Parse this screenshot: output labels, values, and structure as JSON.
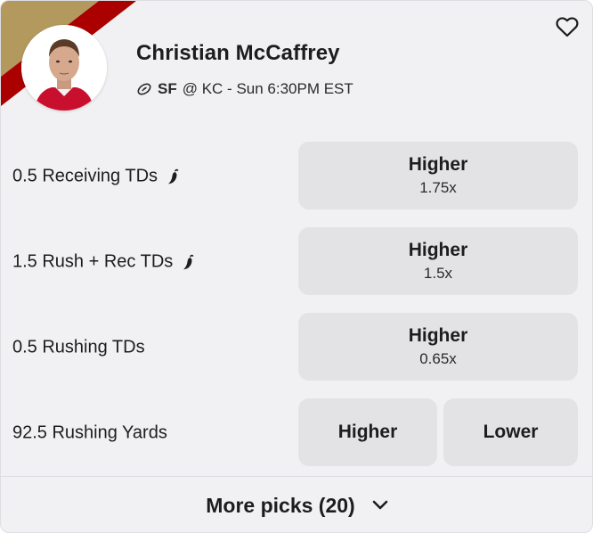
{
  "colors": {
    "card_bg": "#f1f1f3",
    "button_bg": "#e3e3e6",
    "team_gold": "#b3995d",
    "team_red": "#aa0000"
  },
  "player": {
    "name": "Christian McCaffrey",
    "team": "SF",
    "matchup": "@ KC - Sun 6:30PM EST",
    "sport_icon": "football-icon",
    "avatar": "player-headshot"
  },
  "header": {
    "favorite_icon": "heart-outline-icon"
  },
  "props": [
    {
      "label": "0.5 Receiving TDs",
      "hot_icon": "chili-icon",
      "higher": "Higher",
      "multiplier": "1.75x"
    },
    {
      "label": "1.5 Rush + Rec TDs",
      "hot_icon": "chili-icon",
      "higher": "Higher",
      "multiplier": "1.5x"
    },
    {
      "label": "0.5 Rushing TDs",
      "higher": "Higher",
      "multiplier": "0.65x"
    },
    {
      "label": "92.5 Rushing Yards",
      "higher": "Higher",
      "lower": "Lower"
    }
  ],
  "footer": {
    "more_label": "More picks (20)",
    "chevron_icon": "chevron-down-icon"
  }
}
